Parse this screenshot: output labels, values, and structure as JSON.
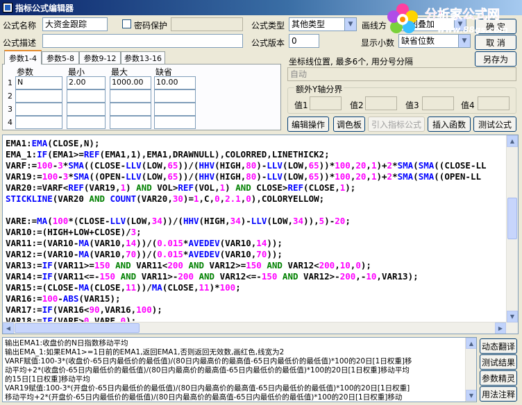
{
  "window": {
    "title": "指标公式编辑器"
  },
  "form": {
    "name_label": "公式名称",
    "name_value": "大资金跟踪",
    "password_label": "密码保护",
    "desc_label": "公式描述",
    "desc_value": "",
    "type_label": "公式类型",
    "type_value": "其他类型",
    "draw_label": "画线方",
    "draw_value": "主图叠加",
    "version_label": "公式版本",
    "version_value": "0",
    "decimal_label": "显示小数",
    "decimal_value": "缺省位数"
  },
  "buttons": {
    "ok": "确 定",
    "cancel": "取 消",
    "save_as": "另存为",
    "edit_ops": "编辑操作",
    "palette": "调色板",
    "import_formula": "引入指标公式",
    "insert_func": "插入函数",
    "test_formula": "测试公式",
    "dyn_translate": "动态翻译",
    "test_result": "测试结果",
    "param_wizard": "参数精灵",
    "usage_notes": "用法注释"
  },
  "tabs": [
    "参数1-4",
    "参数5-8",
    "参数9-12",
    "参数13-16"
  ],
  "params": {
    "headers": [
      "参数",
      "最小",
      "最大",
      "缺省"
    ],
    "rows": [
      {
        "num": "1",
        "name": "N",
        "min": "2.00",
        "max": "1000.00",
        "def": "10.00"
      },
      {
        "num": "2",
        "name": "",
        "min": "",
        "max": "",
        "def": ""
      },
      {
        "num": "3",
        "name": "",
        "min": "",
        "max": "",
        "def": ""
      },
      {
        "num": "4",
        "name": "",
        "min": "",
        "max": "",
        "def": ""
      }
    ]
  },
  "axis": {
    "label": "坐标线位置, 最多6个, 用分号分隔",
    "value": "自动",
    "extra_label": "额外Y轴分界",
    "y_labels": [
      "值1",
      "值2",
      "值3",
      "值4"
    ]
  },
  "code_lines": [
    [
      [
        "EMA1:",
        "t"
      ],
      [
        "EMA",
        "f"
      ],
      [
        "(CLOSE,N);",
        "t"
      ]
    ],
    [
      [
        "EMA_1:",
        "t"
      ],
      [
        "IF",
        "f"
      ],
      [
        "(EMA1>=",
        "t"
      ],
      [
        "REF",
        "f"
      ],
      [
        "(EMA1,1),EMA1,DRAWNULL),COLORRED,LINETHICK2;",
        "t"
      ]
    ],
    [
      [
        "VARF:=",
        "t"
      ],
      [
        "100",
        "n"
      ],
      [
        "-",
        "t"
      ],
      [
        "3",
        "n"
      ],
      [
        "*",
        "t"
      ],
      [
        "SMA",
        "f"
      ],
      [
        "((CLOSE-",
        "t"
      ],
      [
        "LLV",
        "f"
      ],
      [
        "(LOW,",
        "t"
      ],
      [
        "65",
        "n"
      ],
      [
        "))/(",
        "t"
      ],
      [
        "HHV",
        "f"
      ],
      [
        "(HIGH,",
        "t"
      ],
      [
        "80",
        "n"
      ],
      [
        ")-",
        "t"
      ],
      [
        "LLV",
        "f"
      ],
      [
        "(LOW,",
        "t"
      ],
      [
        "65",
        "n"
      ],
      [
        "))*",
        "t"
      ],
      [
        "100",
        "n"
      ],
      [
        ",",
        "t"
      ],
      [
        "20",
        "n"
      ],
      [
        ",",
        "t"
      ],
      [
        "1",
        "n"
      ],
      [
        ")+",
        "t"
      ],
      [
        "2",
        "n"
      ],
      [
        "*",
        "t"
      ],
      [
        "SMA",
        "f"
      ],
      [
        "(",
        "t"
      ],
      [
        "SMA",
        "f"
      ],
      [
        "((CLOSE-LL",
        "t"
      ]
    ],
    [
      [
        "VAR19:=",
        "t"
      ],
      [
        "100",
        "n"
      ],
      [
        "-",
        "t"
      ],
      [
        "3",
        "n"
      ],
      [
        "*",
        "t"
      ],
      [
        "SMA",
        "f"
      ],
      [
        "((OPEN-",
        "t"
      ],
      [
        "LLV",
        "f"
      ],
      [
        "(LOW,",
        "t"
      ],
      [
        "65",
        "n"
      ],
      [
        "))/(",
        "t"
      ],
      [
        "HHV",
        "f"
      ],
      [
        "(HIGH,",
        "t"
      ],
      [
        "80",
        "n"
      ],
      [
        ")-",
        "t"
      ],
      [
        "LLV",
        "f"
      ],
      [
        "(LOW,",
        "t"
      ],
      [
        "65",
        "n"
      ],
      [
        "))*",
        "t"
      ],
      [
        "100",
        "n"
      ],
      [
        ",",
        "t"
      ],
      [
        "20",
        "n"
      ],
      [
        ",",
        "t"
      ],
      [
        "1",
        "n"
      ],
      [
        ")+",
        "t"
      ],
      [
        "2",
        "n"
      ],
      [
        "*",
        "t"
      ],
      [
        "SMA",
        "f"
      ],
      [
        "(",
        "t"
      ],
      [
        "SMA",
        "f"
      ],
      [
        "((OPEN-LL",
        "t"
      ]
    ],
    [
      [
        "VAR20:=VARF<",
        "t"
      ],
      [
        "REF",
        "f"
      ],
      [
        "(VAR19,",
        "t"
      ],
      [
        "1",
        "n"
      ],
      [
        ") ",
        "t"
      ],
      [
        "AND",
        "k"
      ],
      [
        " VOL>",
        "t"
      ],
      [
        "REF",
        "f"
      ],
      [
        "(VOL,",
        "t"
      ],
      [
        "1",
        "n"
      ],
      [
        ") ",
        "t"
      ],
      [
        "AND",
        "k"
      ],
      [
        " CLOSE>",
        "t"
      ],
      [
        "REF",
        "f"
      ],
      [
        "(CLOSE,",
        "t"
      ],
      [
        "1",
        "n"
      ],
      [
        ");",
        "t"
      ]
    ],
    [
      [
        "STICKLINE",
        "f"
      ],
      [
        "(VAR20 ",
        "t"
      ],
      [
        "AND",
        "k"
      ],
      [
        " ",
        "t"
      ],
      [
        "COUNT",
        "f"
      ],
      [
        "(VAR20,",
        "t"
      ],
      [
        "30",
        "n"
      ],
      [
        ")=",
        "t"
      ],
      [
        "1",
        "n"
      ],
      [
        ",C,",
        "t"
      ],
      [
        "0",
        "n"
      ],
      [
        ",",
        "t"
      ],
      [
        "2.1",
        "n"
      ],
      [
        ",",
        "t"
      ],
      [
        "0",
        "n"
      ],
      [
        "),COLORYELLOW;",
        "t"
      ]
    ],
    [
      [
        "",
        "t"
      ]
    ],
    [
      [
        "VARE:=",
        "t"
      ],
      [
        "MA",
        "f"
      ],
      [
        "(",
        "t"
      ],
      [
        "100",
        "n"
      ],
      [
        "*(CLOSE-",
        "t"
      ],
      [
        "LLV",
        "f"
      ],
      [
        "(LOW,",
        "t"
      ],
      [
        "34",
        "n"
      ],
      [
        "))/(",
        "t"
      ],
      [
        "HHV",
        "f"
      ],
      [
        "(HIGH,",
        "t"
      ],
      [
        "34",
        "n"
      ],
      [
        ")-",
        "t"
      ],
      [
        "LLV",
        "f"
      ],
      [
        "(LOW,",
        "t"
      ],
      [
        "34",
        "n"
      ],
      [
        ")),",
        "t"
      ],
      [
        "5",
        "n"
      ],
      [
        ")-",
        "t"
      ],
      [
        "20",
        "n"
      ],
      [
        ";",
        "t"
      ]
    ],
    [
      [
        "VAR10:=(HIGH+LOW+CLOSE)/",
        "t"
      ],
      [
        "3",
        "n"
      ],
      [
        ";",
        "t"
      ]
    ],
    [
      [
        "VAR11:=(VAR10-",
        "t"
      ],
      [
        "MA",
        "f"
      ],
      [
        "(VAR10,",
        "t"
      ],
      [
        "14",
        "n"
      ],
      [
        "))/(",
        "t"
      ],
      [
        "0.015",
        "n"
      ],
      [
        "*",
        "t"
      ],
      [
        "AVEDEV",
        "f"
      ],
      [
        "(VAR10,",
        "t"
      ],
      [
        "14",
        "n"
      ],
      [
        "));",
        "t"
      ]
    ],
    [
      [
        "VAR12:=(VAR10-",
        "t"
      ],
      [
        "MA",
        "f"
      ],
      [
        "(VAR10,",
        "t"
      ],
      [
        "70",
        "n"
      ],
      [
        "))/(",
        "t"
      ],
      [
        "0.015",
        "n"
      ],
      [
        "*",
        "t"
      ],
      [
        "AVEDEV",
        "f"
      ],
      [
        "(VAR10,",
        "t"
      ],
      [
        "70",
        "n"
      ],
      [
        "));",
        "t"
      ]
    ],
    [
      [
        "VAR13:=",
        "t"
      ],
      [
        "IF",
        "f"
      ],
      [
        "(VAR11>=",
        "t"
      ],
      [
        "150",
        "n"
      ],
      [
        " ",
        "t"
      ],
      [
        "AND",
        "k"
      ],
      [
        " VAR11<",
        "t"
      ],
      [
        "200",
        "n"
      ],
      [
        " ",
        "t"
      ],
      [
        "AND",
        "k"
      ],
      [
        " VAR12>=",
        "t"
      ],
      [
        "150",
        "n"
      ],
      [
        " ",
        "t"
      ],
      [
        "AND",
        "k"
      ],
      [
        " VAR12<",
        "t"
      ],
      [
        "200",
        "n"
      ],
      [
        ",",
        "t"
      ],
      [
        "10",
        "n"
      ],
      [
        ",",
        "t"
      ],
      [
        "0",
        "n"
      ],
      [
        ");",
        "t"
      ]
    ],
    [
      [
        "VAR14:=",
        "t"
      ],
      [
        "IF",
        "f"
      ],
      [
        "(VAR11<=-",
        "t"
      ],
      [
        "150",
        "n"
      ],
      [
        " ",
        "t"
      ],
      [
        "AND",
        "k"
      ],
      [
        " VAR11>-",
        "t"
      ],
      [
        "200",
        "n"
      ],
      [
        " ",
        "t"
      ],
      [
        "AND",
        "k"
      ],
      [
        " VAR12<=-",
        "t"
      ],
      [
        "150",
        "n"
      ],
      [
        " ",
        "t"
      ],
      [
        "AND",
        "k"
      ],
      [
        " VAR12>-",
        "t"
      ],
      [
        "200",
        "n"
      ],
      [
        ",-",
        "t"
      ],
      [
        "10",
        "n"
      ],
      [
        ",VAR13);",
        "t"
      ]
    ],
    [
      [
        "VAR15:=(CLOSE-",
        "t"
      ],
      [
        "MA",
        "f"
      ],
      [
        "(CLOSE,",
        "t"
      ],
      [
        "11",
        "n"
      ],
      [
        "))/",
        "t"
      ],
      [
        "MA",
        "f"
      ],
      [
        "(CLOSE,",
        "t"
      ],
      [
        "11",
        "n"
      ],
      [
        ")*",
        "t"
      ],
      [
        "100",
        "n"
      ],
      [
        ";",
        "t"
      ]
    ],
    [
      [
        "VAR16:=",
        "t"
      ],
      [
        "100",
        "n"
      ],
      [
        "-",
        "t"
      ],
      [
        "ABS",
        "f"
      ],
      [
        "(VAR15);",
        "t"
      ]
    ],
    [
      [
        "VAR17:=",
        "t"
      ],
      [
        "IF",
        "f"
      ],
      [
        "(VAR16<",
        "t"
      ],
      [
        "90",
        "n"
      ],
      [
        ",VAR16,",
        "t"
      ],
      [
        "100",
        "n"
      ],
      [
        ");",
        "t"
      ]
    ],
    [
      [
        "VAR18:=",
        "t"
      ],
      [
        "IF",
        "f"
      ],
      [
        "(VARE>",
        "t"
      ],
      [
        "0",
        "n"
      ],
      [
        ",VARE,",
        "t"
      ],
      [
        "0",
        "n"
      ],
      [
        ");",
        "t"
      ]
    ]
  ],
  "output_lines": [
    "输出EMA1:收盘价的N日指数移动平均",
    "输出EMA_1:如果EMA1>=1日前的EMA1,返回EMA1,否则返回无效数,画红色,线宽为2",
    "VARF赋值:100-3*(收盘价-65日内最低价的最低值)/(80日内最高价的最高值-65日内最低价的最低值)*100的20日[1日权重]移",
    "动平均+2*(收盘价-65日内最低价的最低值)/(80日内最高价的最高值-65日内最低价的最低值)*100的20日[1日权重]移动平均",
    "的15日[1日权重]移动平均",
    "VAR19赋值:100-3*(开盘价-65日内最低价的最低值)/(80日内最高价的最高值-65日内最低价的最低值)*100的20日[1日权重]",
    "移动平均+2*(开盘价-65日内最低价的最低值)/(80日内最高价的最高值-65日内最低价的最低值)*100的20日[1日权重]移动"
  ],
  "logo": {
    "text": "分析家公式网",
    "url": "www.88gs.com"
  },
  "colors": {
    "text": "#000000",
    "function": "#0000ff",
    "number": "#ff00ff",
    "keyword": "#008000",
    "title_start": "#0a246a",
    "title_end": "#a6caf0"
  }
}
